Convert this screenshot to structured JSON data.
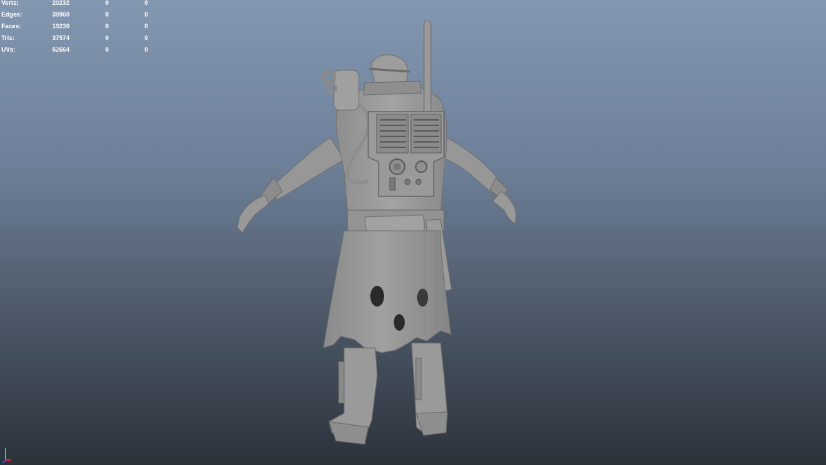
{
  "hud": {
    "rows": [
      {
        "label": "Verts:",
        "c1": "20232",
        "c2": "0",
        "c3": "0"
      },
      {
        "label": "Edges:",
        "c1": "38960",
        "c2": "0",
        "c3": "0"
      },
      {
        "label": "Faces:",
        "c1": "19230",
        "c2": "0",
        "c3": "0"
      },
      {
        "label": "Tris:",
        "c1": "37574",
        "c2": "0",
        "c3": "0"
      },
      {
        "label": "UVs:",
        "c1": "52664",
        "c2": "0",
        "c3": "0"
      }
    ]
  },
  "colors": {
    "model_fill": "#9a9a9a",
    "model_shadow": "#7a7a7a",
    "model_dark": "#555555",
    "gizmo_x": "#ff3030",
    "gizmo_y": "#40ff40"
  }
}
